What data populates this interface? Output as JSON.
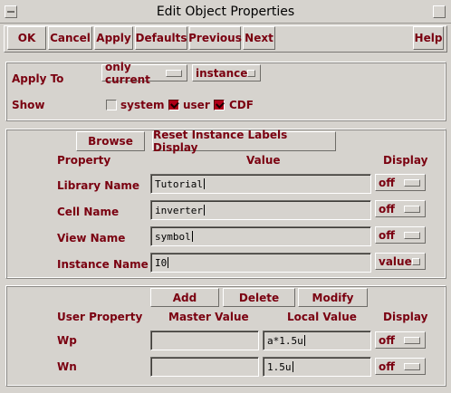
{
  "window": {
    "title": "Edit Object Properties"
  },
  "toolbar": {
    "ok": "OK",
    "cancel": "Cancel",
    "apply": "Apply",
    "defaults": "Defaults",
    "previous": "Previous",
    "next": "Next",
    "help": "Help"
  },
  "apply_section": {
    "apply_to_label": "Apply To",
    "apply_to_scope": "only current",
    "apply_to_type": "instance",
    "show_label": "Show",
    "show_options": [
      {
        "label": "system",
        "checked": false
      },
      {
        "label": "user",
        "checked": true
      },
      {
        "label": "CDF",
        "checked": true
      }
    ]
  },
  "instance_section": {
    "browse_button": "Browse",
    "reset_button": "Reset Instance Labels Display",
    "headers": {
      "property": "Property",
      "value": "Value",
      "display": "Display"
    },
    "rows": [
      {
        "property": "Library Name",
        "value": "Tutorial",
        "display": "off"
      },
      {
        "property": "Cell Name",
        "value": "inverter",
        "display": "off"
      },
      {
        "property": "View Name",
        "value": "symbol",
        "display": "off"
      },
      {
        "property": "Instance Name",
        "value": "I0",
        "display": "value"
      }
    ]
  },
  "user_section": {
    "add_button": "Add",
    "delete_button": "Delete",
    "modify_button": "Modify",
    "headers": {
      "user_property": "User Property",
      "master_value": "Master Value",
      "local_value": "Local Value",
      "display": "Display"
    },
    "rows": [
      {
        "property": "Wp",
        "master_value": "",
        "local_value": "a*1.5u",
        "display": "off"
      },
      {
        "property": "Wn",
        "master_value": "",
        "local_value": "1.5u",
        "display": "off"
      }
    ]
  }
}
